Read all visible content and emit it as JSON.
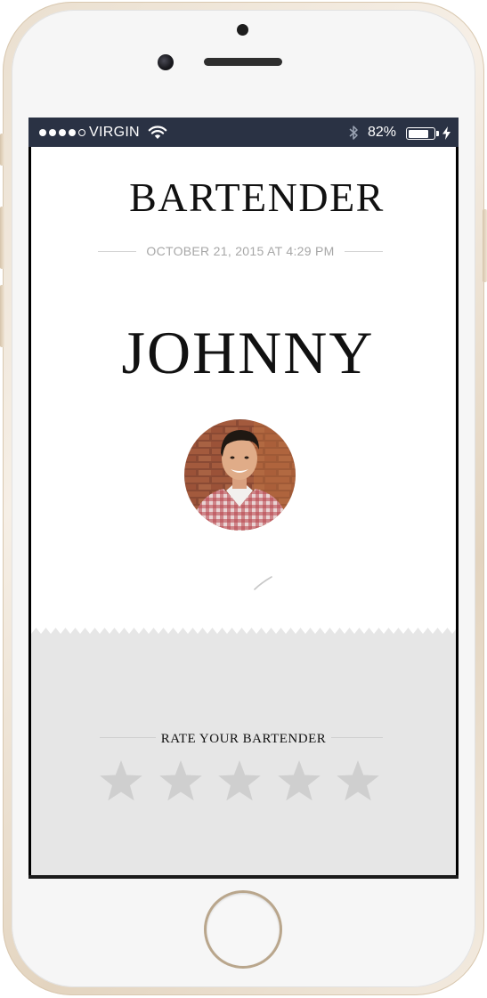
{
  "status_bar": {
    "carrier": "VIRGIN",
    "signal_bars_filled": 4,
    "signal_bars_total": 5,
    "battery_percent": "82%",
    "battery_level": 0.82,
    "icons": [
      "wifi-icon",
      "bluetooth-icon",
      "battery-icon",
      "charging-icon"
    ]
  },
  "header": {
    "title": "BARTENDER",
    "date": "OCTOBER 21, 2015 AT 4:29 PM"
  },
  "bartender": {
    "name": "JOHNNY",
    "avatar": "avatar-photo"
  },
  "rating": {
    "label": "RATE YOUR BARTENDER",
    "max_stars": 5,
    "selected_stars": 0,
    "star_color": "#cfcfcf"
  },
  "colors": {
    "status_bar_bg": "#2a3244",
    "panel_bg": "#e6e6e6",
    "text": "#111111",
    "date_text": "#a7a7a7"
  }
}
